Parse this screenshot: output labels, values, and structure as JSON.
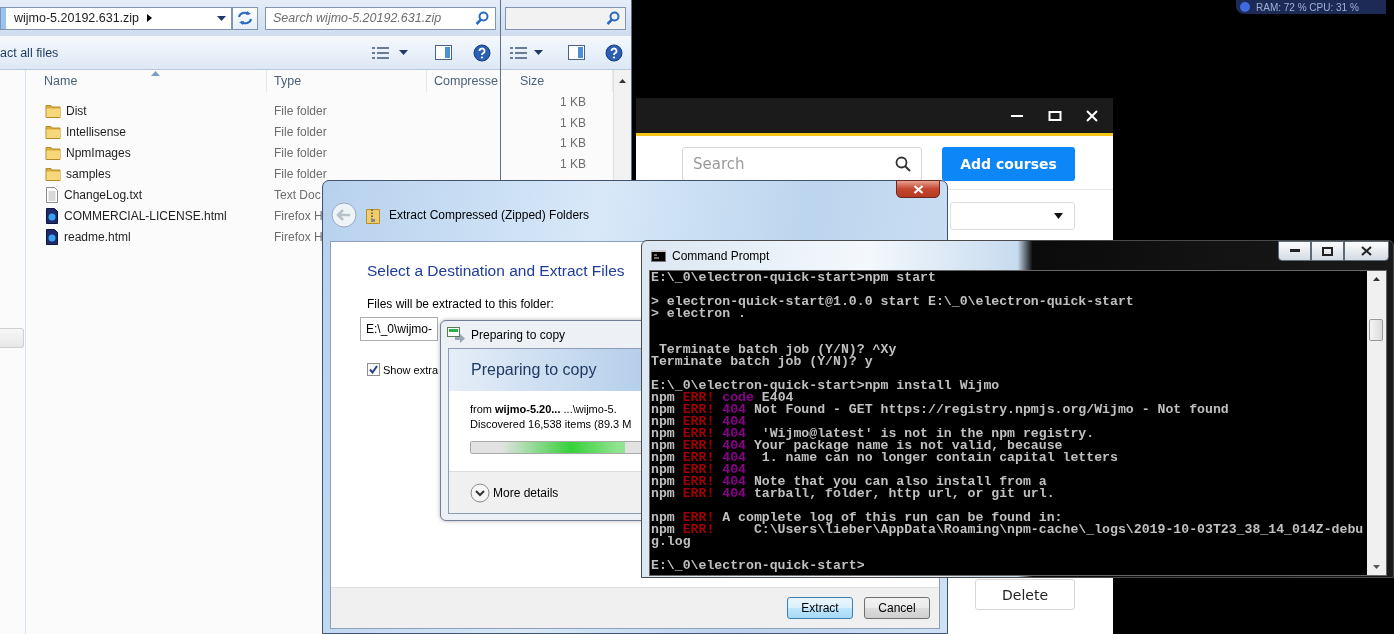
{
  "explorer_back": {
    "size_column": "Size",
    "sizes": [
      "1 KB",
      "1 KB",
      "1 KB",
      "1 KB"
    ]
  },
  "explorer_front": {
    "address": "wijmo-5.20192.631.zip",
    "search": {
      "placeholder": "Search wijmo-5.20192.631.zip"
    },
    "toolbar_action": "act all files",
    "columns": [
      "Name",
      "Type",
      "Compresse"
    ],
    "rows": [
      {
        "name": "Dist",
        "type": "File folder",
        "kind": "folder"
      },
      {
        "name": "Intellisense",
        "type": "File folder",
        "kind": "folder"
      },
      {
        "name": "NpmImages",
        "type": "File folder",
        "kind": "folder"
      },
      {
        "name": "samples",
        "type": "File folder",
        "kind": "folder"
      },
      {
        "name": "ChangeLog.txt",
        "type": "Text Doc",
        "kind": "text"
      },
      {
        "name": "COMMERCIAL-LICENSE.html",
        "type": "Firefox H",
        "kind": "html"
      },
      {
        "name": "readme.html",
        "type": "Firefox H",
        "kind": "html"
      }
    ]
  },
  "system_monitor": {
    "text": "RAM: 72 % CPU: 31 %"
  },
  "app": {
    "search": {
      "placeholder": "Search"
    },
    "add_button": "Add courses",
    "delete_button": "Delete"
  },
  "extract_dialog": {
    "title": "Extract Compressed (Zipped) Folders",
    "heading": "Select a Destination and Extract Files",
    "folder_label": "Files will be extracted to this folder:",
    "folder_path": "E:\\_0\\wijmo-",
    "show_files": {
      "label": "Show extra",
      "checked": true
    },
    "buttons": [
      {
        "label": "Extract",
        "default": true
      },
      {
        "label": "Cancel",
        "default": false
      }
    ]
  },
  "copy_dialog": {
    "title": "Preparing to copy",
    "heading": "Preparing to copy",
    "from": "from **wijmo-5.20...**  ...\\wijmo-5.",
    "discovered": "Discovered 16,538 items (89.3 M",
    "progress": {
      "level": 0.8
    },
    "details": "More details"
  },
  "command_prompt": {
    "title": "Command Prompt",
    "lines": [
      {
        "kind": "text",
        "segments": [
          {
            "text": "E:\\_0\\electron-quick-start>npm start",
            "kind": "plain"
          }
        ]
      },
      {
        "kind": "blank"
      },
      {
        "kind": "text",
        "segments": [
          {
            "text": "> electron-quick-start@1.0.0 start E:\\_0\\electron-quick-start",
            "kind": "plain"
          }
        ]
      },
      {
        "kind": "text",
        "segments": [
          {
            "text": "> electron .",
            "kind": "plain"
          }
        ]
      },
      {
        "kind": "blank"
      },
      {
        "kind": "blank"
      },
      {
        "kind": "text",
        "segments": [
          {
            "text": " Terminate batch job (Y/N)? ^Xy",
            "kind": "plain"
          }
        ]
      },
      {
        "kind": "text",
        "segments": [
          {
            "text": "Terminate batch job (Y/N)? y",
            "kind": "plain"
          }
        ]
      },
      {
        "kind": "blank"
      },
      {
        "kind": "text",
        "segments": [
          {
            "text": "E:\\_0\\electron-quick-start>npm install Wijmo",
            "kind": "plain"
          }
        ]
      },
      {
        "kind": "text",
        "segments": [
          {
            "text": "npm ",
            "kind": "plain"
          },
          {
            "text": "ERR!",
            "kind": "error"
          },
          {
            "text": " code",
            "kind": "status"
          },
          {
            "text": " E404",
            "kind": "plain"
          }
        ]
      },
      {
        "kind": "text",
        "segments": [
          {
            "text": "npm ",
            "kind": "plain"
          },
          {
            "text": "ERR!",
            "kind": "error"
          },
          {
            "text": " 404",
            "kind": "status"
          },
          {
            "text": " Not Found - GET https://registry.npmjs.org/Wijmo - Not found",
            "kind": "plain"
          }
        ]
      },
      {
        "kind": "text",
        "segments": [
          {
            "text": "npm ",
            "kind": "plain"
          },
          {
            "text": "ERR!",
            "kind": "error"
          },
          {
            "text": " 404",
            "kind": "status"
          }
        ]
      },
      {
        "kind": "text",
        "segments": [
          {
            "text": "npm ",
            "kind": "plain"
          },
          {
            "text": "ERR!",
            "kind": "error"
          },
          {
            "text": " 404",
            "kind": "status"
          },
          {
            "text": "  'Wijmo@latest' is not in the npm registry.",
            "kind": "plain"
          }
        ]
      },
      {
        "kind": "text",
        "segments": [
          {
            "text": "npm ",
            "kind": "plain"
          },
          {
            "text": "ERR!",
            "kind": "error"
          },
          {
            "text": " 404",
            "kind": "status"
          },
          {
            "text": " Your package name is not valid, because",
            "kind": "plain"
          }
        ]
      },
      {
        "kind": "text",
        "segments": [
          {
            "text": "npm ",
            "kind": "plain"
          },
          {
            "text": "ERR!",
            "kind": "error"
          },
          {
            "text": " 404",
            "kind": "status"
          },
          {
            "text": "  1. name can no longer contain capital letters",
            "kind": "plain"
          }
        ]
      },
      {
        "kind": "text",
        "segments": [
          {
            "text": "npm ",
            "kind": "plain"
          },
          {
            "text": "ERR!",
            "kind": "error"
          },
          {
            "text": " 404",
            "kind": "status"
          }
        ]
      },
      {
        "kind": "text",
        "segments": [
          {
            "text": "npm ",
            "kind": "plain"
          },
          {
            "text": "ERR!",
            "kind": "error"
          },
          {
            "text": " 404",
            "kind": "status"
          },
          {
            "text": " Note that you can also install from a",
            "kind": "plain"
          }
        ]
      },
      {
        "kind": "text",
        "segments": [
          {
            "text": "npm ",
            "kind": "plain"
          },
          {
            "text": "ERR!",
            "kind": "error"
          },
          {
            "text": " 404",
            "kind": "status"
          },
          {
            "text": " tarball, folder, http url, or git url.",
            "kind": "plain"
          }
        ]
      },
      {
        "kind": "blank"
      },
      {
        "kind": "text",
        "segments": [
          {
            "text": "npm ",
            "kind": "plain"
          },
          {
            "text": "ERR!",
            "kind": "error"
          },
          {
            "text": " A complete log of this run can be found in:",
            "kind": "plain"
          }
        ]
      },
      {
        "kind": "text",
        "segments": [
          {
            "text": "npm ",
            "kind": "plain"
          },
          {
            "text": "ERR!",
            "kind": "error"
          },
          {
            "text": "     C:\\Users\\lieber\\AppData\\Roaming\\npm-cache\\_logs\\2019-10-03T23_38_14_014Z-debu",
            "kind": "plain"
          }
        ]
      },
      {
        "kind": "text",
        "segments": [
          {
            "text": "g.log",
            "kind": "plain"
          }
        ]
      },
      {
        "kind": "blank"
      },
      {
        "kind": "text",
        "segments": [
          {
            "text": "E:\\_0\\electron-quick-start>",
            "kind": "plain"
          }
        ]
      }
    ]
  }
}
